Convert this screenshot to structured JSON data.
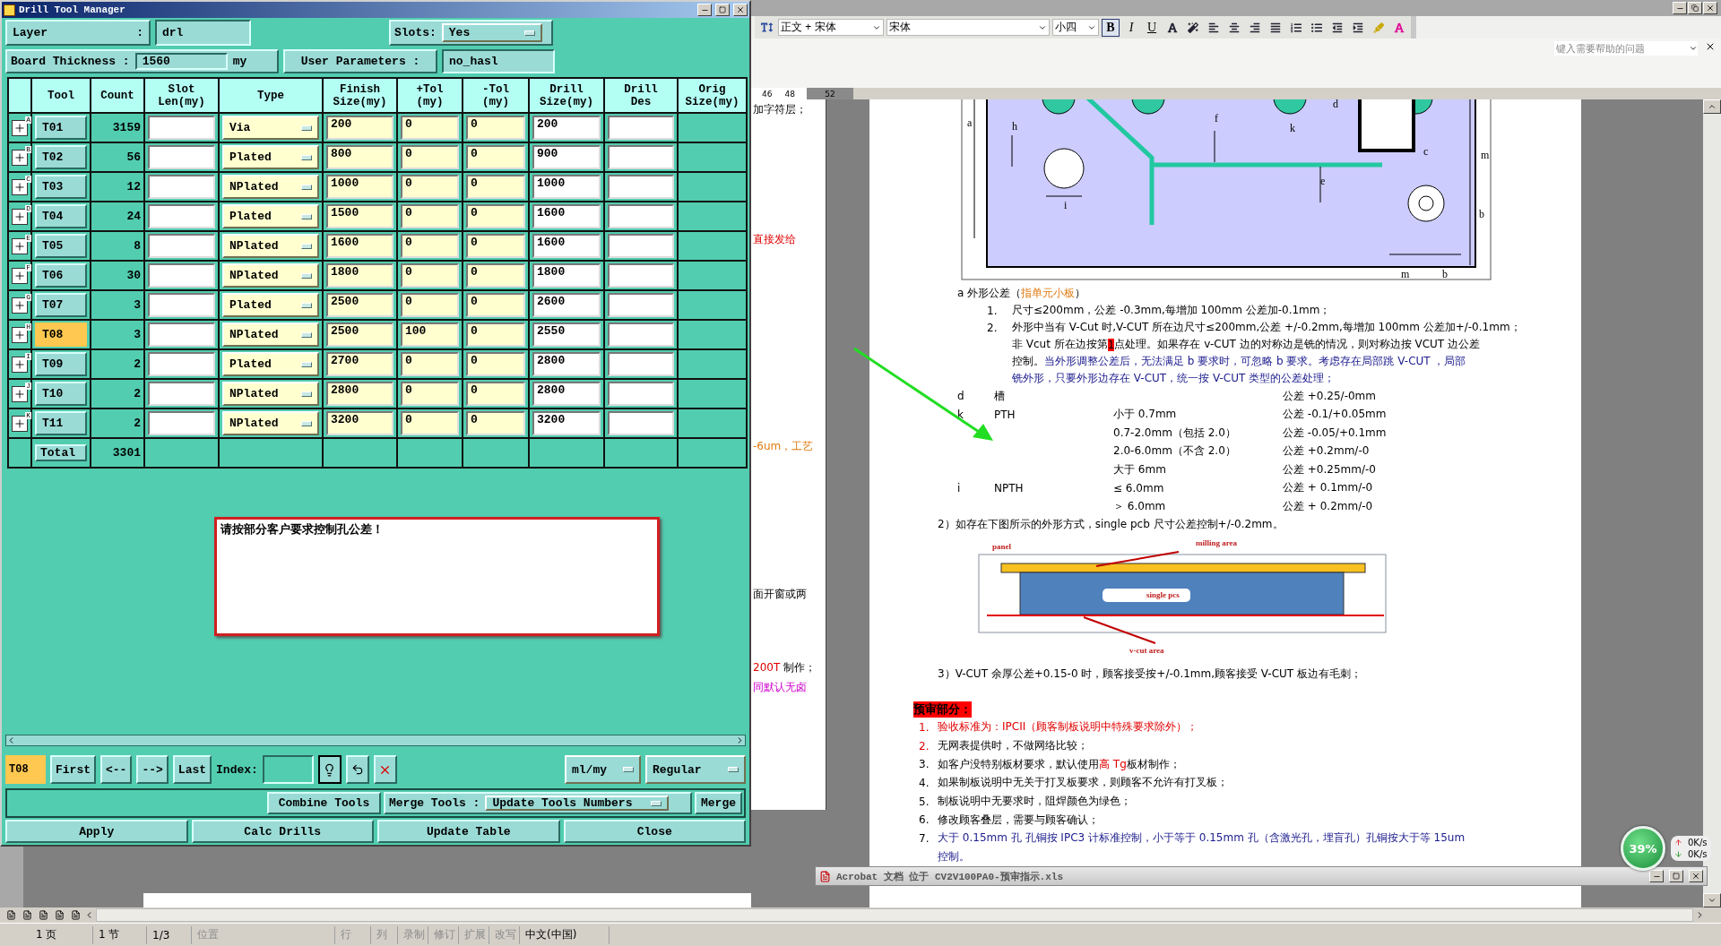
{
  "dialog": {
    "title": "Drill Tool Manager",
    "layer": {
      "label": "Layer",
      "colon": ":",
      "value": "drl"
    },
    "slots": {
      "label": "Slots:",
      "value": "Yes"
    },
    "thickness": {
      "label": "Board Thickness :",
      "value": "1560",
      "unit": "my"
    },
    "user_params": {
      "label": "User Parameters :",
      "value": "no_hasl"
    },
    "columns": [
      "Tool",
      "Count",
      "Slot\nLen(my)",
      "Type",
      "Finish\nSize(my)",
      "+Tol\n(my)",
      "-Tol\n(my)",
      "Drill\nSize(my)",
      "Drill\nDes",
      "Orig\nSize(my)"
    ],
    "rows": [
      {
        "mark": "A",
        "tool": "T01",
        "count": "3159",
        "type": "Via",
        "finish": "200",
        "plus_tol": "0",
        "minus_tol": "0",
        "drill": "200",
        "selected": false
      },
      {
        "mark": "B",
        "tool": "T02",
        "count": "56",
        "type": "Plated",
        "finish": "800",
        "plus_tol": "0",
        "minus_tol": "0",
        "drill": "900",
        "selected": false
      },
      {
        "mark": "C",
        "tool": "T03",
        "count": "12",
        "type": "NPlated",
        "finish": "1000",
        "plus_tol": "0",
        "minus_tol": "0",
        "drill": "1000",
        "selected": false
      },
      {
        "mark": "D",
        "tool": "T04",
        "count": "24",
        "type": "Plated",
        "finish": "1500",
        "plus_tol": "0",
        "minus_tol": "0",
        "drill": "1600",
        "selected": false
      },
      {
        "mark": "E",
        "tool": "T05",
        "count": "8",
        "type": "NPlated",
        "finish": "1600",
        "plus_tol": "0",
        "minus_tol": "0",
        "drill": "1600",
        "selected": false
      },
      {
        "mark": "F",
        "tool": "T06",
        "count": "30",
        "type": "NPlated",
        "finish": "1800",
        "plus_tol": "0",
        "minus_tol": "0",
        "drill": "1800",
        "selected": false
      },
      {
        "mark": "G",
        "tool": "T07",
        "count": "3",
        "type": "Plated",
        "finish": "2500",
        "plus_tol": "0",
        "minus_tol": "0",
        "drill": "2600",
        "selected": false
      },
      {
        "mark": "H",
        "tool": "T08",
        "count": "3",
        "type": "NPlated",
        "finish": "2500",
        "plus_tol": "100",
        "minus_tol": "0",
        "drill": "2550",
        "selected": true
      },
      {
        "mark": "I",
        "tool": "T09",
        "count": "2",
        "type": "Plated",
        "finish": "2700",
        "plus_tol": "0",
        "minus_tol": "0",
        "drill": "2800",
        "selected": false
      },
      {
        "mark": "J",
        "tool": "T10",
        "count": "2",
        "type": "NPlated",
        "finish": "2800",
        "plus_tol": "0",
        "minus_tol": "0",
        "drill": "2800",
        "selected": false
      },
      {
        "mark": "K",
        "tool": "T11",
        "count": "2",
        "type": "NPlated",
        "finish": "3200",
        "plus_tol": "0",
        "minus_tol": "0",
        "drill": "3200",
        "selected": false
      }
    ],
    "total": {
      "label": "Total",
      "count": "3301"
    },
    "note": "请按部分客户要求控制孔公差！",
    "nav": {
      "current": "T08",
      "buttons": [
        "First",
        "<--",
        "-->",
        "Last"
      ],
      "index_label": "Index:",
      "unit": "ml/my",
      "mode": "Regular"
    },
    "merge": {
      "combine": "Combine Tools",
      "label": "Merge Tools :",
      "option": "Update Tools Numbers",
      "button": "Merge"
    },
    "actions": [
      "Apply",
      "Calc Drills",
      "Update Table",
      "Close"
    ]
  },
  "word": {
    "toolbar": {
      "style": "正文 + 宋体",
      "font": "宋体",
      "size": "小四",
      "format_buttons": [
        {
          "label": "B",
          "selected": true
        },
        {
          "label": "I",
          "selected": false
        },
        {
          "label": "U",
          "selected": false
        }
      ]
    },
    "help_placeholder": "键入需要帮助的问题",
    "ruler": [
      "46",
      "48",
      "52"
    ],
    "left_page": [
      [
        {
          "text": "加字符层；",
          "kind": "plain"
        }
      ],
      [
        {
          "text": "直接发给",
          "kind": "red"
        }
      ],
      [
        {
          "text": "-6um，工艺",
          "kind": "orange"
        }
      ],
      [
        {
          "text": "面开窗或两",
          "kind": "plain"
        }
      ],
      [
        {
          "text": "200T",
          "kind": "red"
        },
        {
          "text": " 制作；",
          "kind": "plain"
        }
      ],
      [
        {
          "text": "同默认无卤",
          "kind": "magenta"
        }
      ]
    ],
    "diagram_labels": [
      "a",
      "h",
      "f",
      "k",
      "d",
      "c",
      "m",
      "e",
      "b",
      "i",
      "m",
      "b"
    ],
    "outline_heading": [
      {
        "text": "a 外形公差（",
        "kind": "plain"
      },
      {
        "text": "指单元小板",
        "kind": "orange"
      },
      {
        "text": "）",
        "kind": "plain"
      }
    ],
    "outline_items": [
      {
        "number": "1.",
        "lines": [
          [
            {
              "text": "尺寸≤200mm，公差 -0.3mm,每增加 100mm 公差加-0.1mm；",
              "kind": "plain"
            }
          ]
        ]
      },
      {
        "number": "2.",
        "lines": [
          [
            {
              "text": "外形中当有 V-Cut 时,V-CUT 所在边尺寸≤200mm,公差 +/-0.2mm,每增加 100mm 公差加+/-0.1mm；",
              "kind": "plain"
            }
          ],
          [
            {
              "text": "非 Vcut 所在边按第 ",
              "kind": "plain"
            },
            {
              "text": "1",
              "kind": "highlight"
            },
            {
              "text": "点处理。如果存在 v-CUT 边的对称边是铣的情况，则对称边按 VCUT 边公差",
              "kind": "plain"
            }
          ],
          [
            {
              "text": "控制。",
              "kind": "plain"
            },
            {
              "text": "当外形调整公差后，无法满足 b 要求时，可忽略 b 要求。考虑存在局部跳 V-CUT ，局部",
              "kind": "blue"
            }
          ],
          [
            {
              "text": "铣外形，只要外形边存在 V-CUT，统一按 V-CUT 类型的公差处理；",
              "kind": "blue"
            }
          ]
        ]
      }
    ],
    "tolerance_rows": [
      {
        "mark": "d",
        "feature": "槽",
        "tolerance": "公差 +0.25/-0mm"
      },
      {
        "mark": "k",
        "feature": "PTH",
        "range": "小于 0.7mm",
        "tolerance": "公差 -0.1/+0.05mm"
      },
      {
        "range": "0.7-2.0mm（包括 2.0）",
        "tolerance": "公差  -0.05/+0.1mm"
      },
      {
        "range": "2.0-6.0mm（不含 2.0）",
        "tolerance": "公差 +0.2mm/-0"
      },
      {
        "range": "大于 6mm",
        "tolerance": "公差 +0.25mm/-0"
      },
      {
        "mark": "i",
        "feature": "NPTH",
        "range": "≤ 6.0mm",
        "tolerance": "公差 + 0.1mm/-0"
      },
      {
        "range": "＞ 6.0mm",
        "tolerance": "公差 + 0.2mm/-0"
      }
    ],
    "note_2": "2）如存在下图所示的外形方式，single pcb 尺寸公差控制+/-0.2mm。",
    "figure_labels": [
      "panel",
      "milling area",
      "single pcs",
      "v-cut area"
    ],
    "note_3": "3）V-CUT 余厚公差+0.15-0 时，顾客接受按+/-0.1mm,顾客接受 V-CUT 板边有毛刺；",
    "preaudit_title": "预审部分：",
    "preaudit_items": [
      {
        "number": {
          "text": "1.",
          "kind": "red"
        },
        "lines": [
          [
            {
              "text": "验收标准为：IPCII（顾客制板说明中特殊要求除外）；",
              "kind": "red"
            }
          ]
        ]
      },
      {
        "number": {
          "text": "2.",
          "kind": "red"
        },
        "lines": [
          [
            {
              "text": "无网表提供时，不做网络比较；",
              "kind": "plain"
            }
          ]
        ]
      },
      {
        "number": {
          "text": "3.",
          "kind": "plain"
        },
        "lines": [
          [
            {
              "text": "如客户没特别板材要求，默认使用",
              "kind": "plain"
            },
            {
              "text": "高 Tg",
              "kind": "red"
            },
            {
              "text": " 板材制作；",
              "kind": "plain"
            }
          ]
        ]
      },
      {
        "number": {
          "text": "4.",
          "kind": "plain"
        },
        "lines": [
          [
            {
              "text": "如果制板说明中无关于打叉板要求，则顾客不允许有打叉板；",
              "kind": "plain"
            }
          ]
        ]
      },
      {
        "number": {
          "text": "5.",
          "kind": "plain"
        },
        "lines": [
          [
            {
              "text": "制板说明中无要求时，阻焊颜色为绿色；",
              "kind": "plain"
            }
          ]
        ]
      },
      {
        "number": {
          "text": "6.",
          "kind": "plain"
        },
        "lines": [
          [
            {
              "text": "修改顾客叠层，需要与顾客确认；",
              "kind": "plain"
            }
          ]
        ]
      },
      {
        "number": {
          "text": "7.",
          "kind": "plain"
        },
        "lines": [
          [
            {
              "text": "大于 0.15mm 孔 孔铜按 IPC3 计标准控制，小于等于 0.15mm 孔（含激光孔，埋盲孔）孔铜按大于等 15um",
              "kind": "blue"
            }
          ],
          [
            {
              "text": "控制。",
              "kind": "blue"
            }
          ]
        ]
      }
    ],
    "status": [
      {
        "text": "1 页",
        "disabled": false
      },
      {
        "text": "1 节",
        "disabled": false
      },
      {
        "text": "1/3",
        "disabled": false
      },
      {
        "text": "位置",
        "disabled": true
      },
      {
        "text": "行",
        "disabled": true
      },
      {
        "text": "列",
        "disabled": true
      },
      {
        "text": "录制",
        "disabled": true
      },
      {
        "text": "修订",
        "disabled": true
      },
      {
        "text": "扩展",
        "disabled": true
      },
      {
        "text": "改写",
        "disabled": true
      },
      {
        "text": "中文(中国)",
        "disabled": false
      }
    ]
  },
  "taskbar_window": {
    "title": "Acrobat 文档 位于 CV2V100PA0-预审指示.xls"
  },
  "network_meter": {
    "percent": "39%",
    "upload": "0K/s",
    "download": "0K/s"
  }
}
